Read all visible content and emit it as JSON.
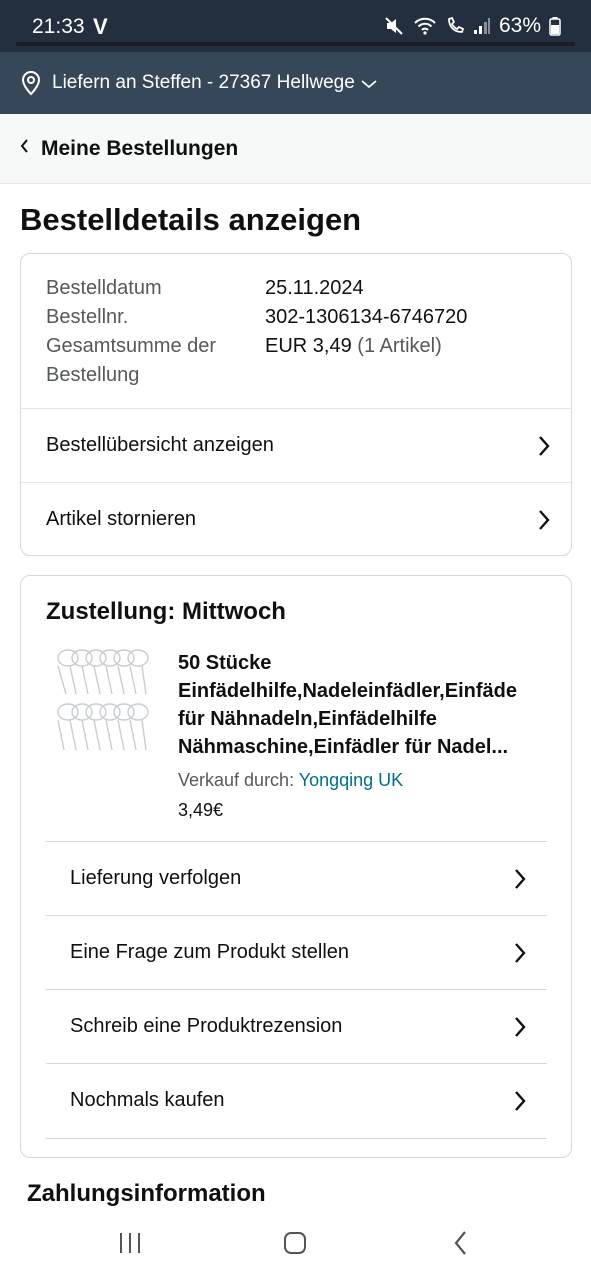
{
  "status_bar": {
    "time": "21:33",
    "carrier_mark": "V",
    "battery": "63%",
    "icons": [
      "mute-icon",
      "wifi-icon",
      "wifi-call-icon",
      "signal-icon",
      "battery-icon"
    ]
  },
  "delivery_bar": {
    "text": "Liefern an Steffen - 27367 Hellwege"
  },
  "back_nav": {
    "label": "Meine Bestellungen"
  },
  "page": {
    "title": "Bestelldetails anzeigen"
  },
  "order_info": {
    "date_label": "Bestelldatum",
    "date_value": "25.11.2024",
    "number_label": "Bestellnr.",
    "number_value": "302-1306134-6746720",
    "total_label": "Gesamtsumme der Bestellung",
    "total_value": "EUR 3,49",
    "total_items": "(1 Artikel)",
    "links": [
      {
        "label": "Bestellübersicht anzeigen"
      },
      {
        "label": "Artikel stornieren"
      }
    ]
  },
  "shipment": {
    "title": "Zustellung: Mittwoch",
    "product": {
      "title_lines": [
        "50 Stücke",
        "Einfädelhilfe,Nadeleinfädler,Einfäde",
        "für Nähnadeln,Einfädelhilfe",
        "Nähmaschine,Einfädler für Nadel..."
      ],
      "seller_label": "Verkauf durch:",
      "seller_name": "Yongqing UK",
      "price": "3,49€"
    },
    "actions": [
      {
        "label": "Lieferung verfolgen"
      },
      {
        "label": "Eine Frage zum Produkt stellen"
      },
      {
        "label": "Schreib eine Produktrezension"
      },
      {
        "label": "Nochmals kaufen"
      }
    ]
  },
  "payment": {
    "title": "Zahlungsinformation"
  },
  "colors": {
    "header_dark": "#232f3e",
    "header_mid": "#37475a",
    "link_teal": "#007185",
    "text": "#0f1111",
    "muted": "#565959",
    "border": "#d5d9d9"
  }
}
